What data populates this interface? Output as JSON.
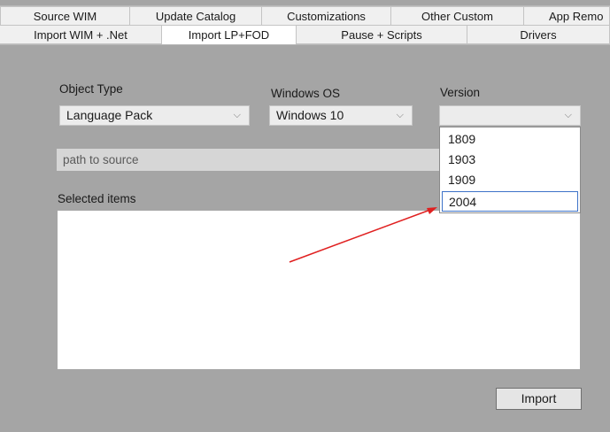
{
  "tabs_row1": [
    {
      "label": "Source WIM",
      "selected": false
    },
    {
      "label": "Update Catalog",
      "selected": false
    },
    {
      "label": "Customizations",
      "selected": false
    },
    {
      "label": "Other Custom",
      "selected": false
    },
    {
      "label": "App Remo",
      "selected": false
    }
  ],
  "tabs_row2": [
    {
      "label": "Import WIM + .Net",
      "selected": false
    },
    {
      "label": "Import LP+FOD",
      "selected": true
    },
    {
      "label": "Pause + Scripts",
      "selected": false
    },
    {
      "label": "Drivers",
      "selected": false
    }
  ],
  "form": {
    "object_type": {
      "label": "Object Type",
      "value": "Language Pack"
    },
    "windows_os": {
      "label": "Windows OS",
      "value": "Windows 10"
    },
    "version": {
      "label": "Version",
      "value": "",
      "options": [
        "1809",
        "1903",
        "1909",
        "2004"
      ],
      "highlighted": "2004"
    },
    "path_placeholder": "path to source",
    "selected_items_label": "Selected items",
    "import_button": "Import"
  },
  "icons": {
    "dropdown_chevron": "chevron-down-icon",
    "annotation_arrow": "red-arrow"
  },
  "colors": {
    "background": "#a5a5a5",
    "arrow": "#e02020",
    "highlight_border": "#3d72c8"
  }
}
